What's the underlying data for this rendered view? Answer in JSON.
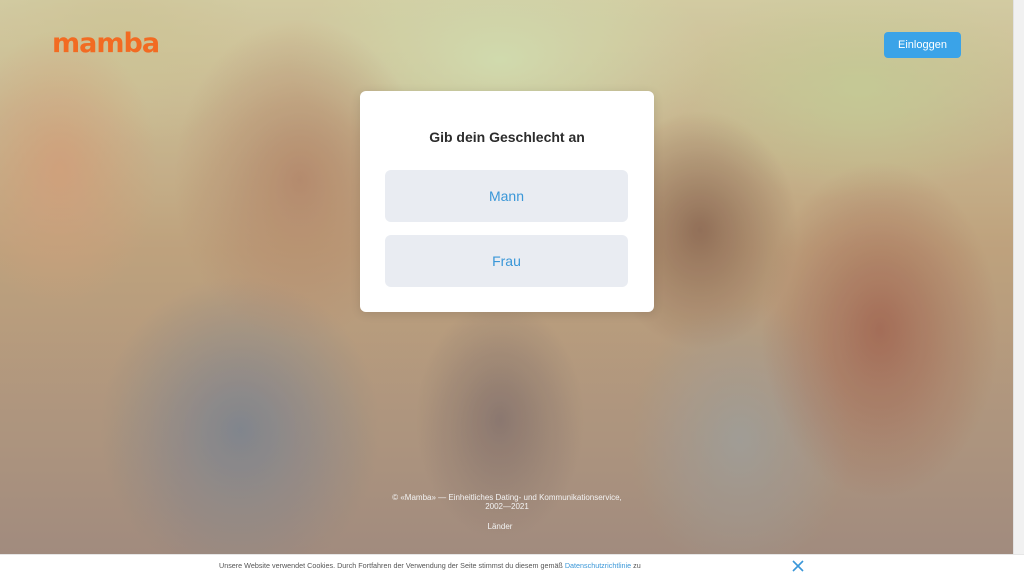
{
  "header": {
    "logo_text": "mamba",
    "login_label": "Einloggen"
  },
  "gender_card": {
    "title": "Gib dein Geschlecht an",
    "options": [
      {
        "label": "Mann"
      },
      {
        "label": "Frau"
      }
    ]
  },
  "footer": {
    "copyright_line1": "© «Mamba» — Einheitliches Dating- und Kommunikationservice,",
    "copyright_line2": "2002—2021",
    "lander_link": "Länder"
  },
  "cookie_banner": {
    "text": "Unsere Website verwendet Cookies. Durch Fortfahren der Verwendung der Seite stimmst du diesem gemäß",
    "link_text": "Datenschutzrichtlinie",
    "text_after": "zu",
    "close_icon": "close-icon"
  },
  "colors": {
    "brand_orange": "#f26b22",
    "accent_blue": "#3aa3e8",
    "choice_bg": "#e9ecf2"
  }
}
